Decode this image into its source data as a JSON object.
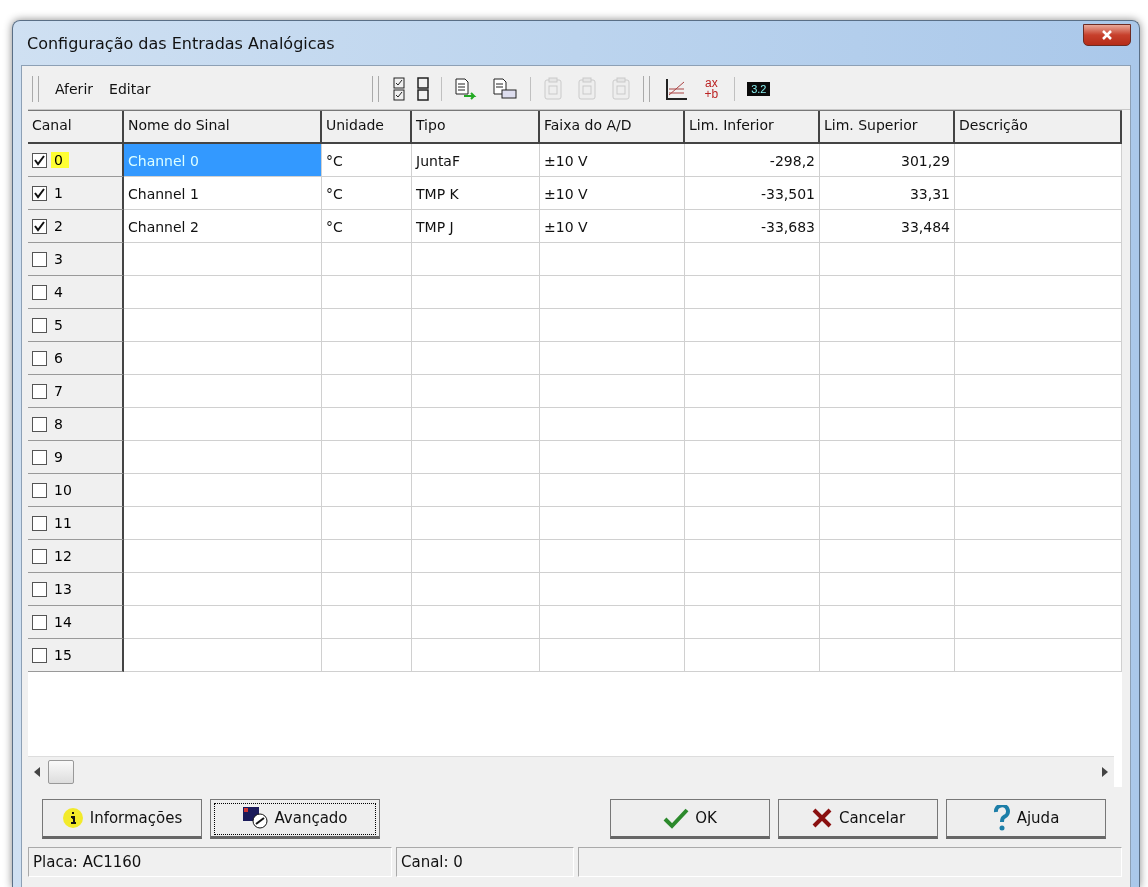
{
  "window": {
    "title": "Configuração das Entradas Analógicas"
  },
  "menu": [
    {
      "label": "Aferir"
    },
    {
      "label": "Editar"
    }
  ],
  "toolbar": [
    {
      "kind": "check-all",
      "disabled": false
    },
    {
      "kind": "uncheck-all",
      "disabled": false
    },
    {
      "kind": "sep"
    },
    {
      "kind": "copy-to",
      "disabled": false
    },
    {
      "kind": "copy-field",
      "disabled": false
    },
    {
      "kind": "sep"
    },
    {
      "kind": "paste-a",
      "disabled": true
    },
    {
      "kind": "paste-b",
      "disabled": true
    },
    {
      "kind": "paste-c",
      "disabled": true
    },
    {
      "kind": "grip"
    },
    {
      "kind": "graph",
      "disabled": false
    },
    {
      "kind": "formula",
      "disabled": false,
      "top": "ax",
      "bottom": "+b"
    },
    {
      "kind": "sep"
    },
    {
      "kind": "display",
      "disabled": false,
      "text": "3.2"
    }
  ],
  "table": {
    "columns": [
      "Canal",
      "Nome do Sinal",
      "Unidade",
      "Tipo",
      "Faixa do A/D",
      "Lim. Inferior",
      "Lim. Superior",
      "Descrição"
    ],
    "rows": [
      {
        "channel": "0",
        "checked": true,
        "selected": true,
        "name": "Channel 0",
        "unit": "°C",
        "type": "JuntaF",
        "range": "±10 V",
        "lower": "-298,2",
        "upper": "301,29"
      },
      {
        "channel": "1",
        "checked": true,
        "selected": false,
        "name": "Channel 1",
        "unit": "°C",
        "type": "TMP K",
        "range": "±10 V",
        "lower": "-33,501",
        "upper": "33,31"
      },
      {
        "channel": "2",
        "checked": true,
        "selected": false,
        "name": "Channel 2",
        "unit": "°C",
        "type": "TMP J",
        "range": "±10 V",
        "lower": "-33,683",
        "upper": "33,484"
      },
      {
        "channel": "3",
        "checked": false,
        "selected": false
      },
      {
        "channel": "4",
        "checked": false,
        "selected": false
      },
      {
        "channel": "5",
        "checked": false,
        "selected": false
      },
      {
        "channel": "6",
        "checked": false,
        "selected": false
      },
      {
        "channel": "7",
        "checked": false,
        "selected": false
      },
      {
        "channel": "8",
        "checked": false,
        "selected": false
      },
      {
        "channel": "9",
        "checked": false,
        "selected": false
      },
      {
        "channel": "10",
        "checked": false,
        "selected": false
      },
      {
        "channel": "11",
        "checked": false,
        "selected": false
      },
      {
        "channel": "12",
        "checked": false,
        "selected": false
      },
      {
        "channel": "13",
        "checked": false,
        "selected": false
      },
      {
        "channel": "14",
        "checked": false,
        "selected": false
      },
      {
        "channel": "15",
        "checked": false,
        "selected": false
      }
    ]
  },
  "buttons": [
    {
      "kind": "info",
      "label": "Informações",
      "focused": false
    },
    {
      "kind": "advanced",
      "label": "Avançado",
      "focused": true
    },
    {
      "kind": "spacer"
    },
    {
      "kind": "ok",
      "label": "OK",
      "focused": false
    },
    {
      "kind": "cancel",
      "label": "Cancelar",
      "focused": false
    },
    {
      "kind": "help",
      "label": "Ajuda",
      "focused": false
    }
  ],
  "status_bar": [
    "Placa: AC1160",
    "Canal: 0"
  ]
}
